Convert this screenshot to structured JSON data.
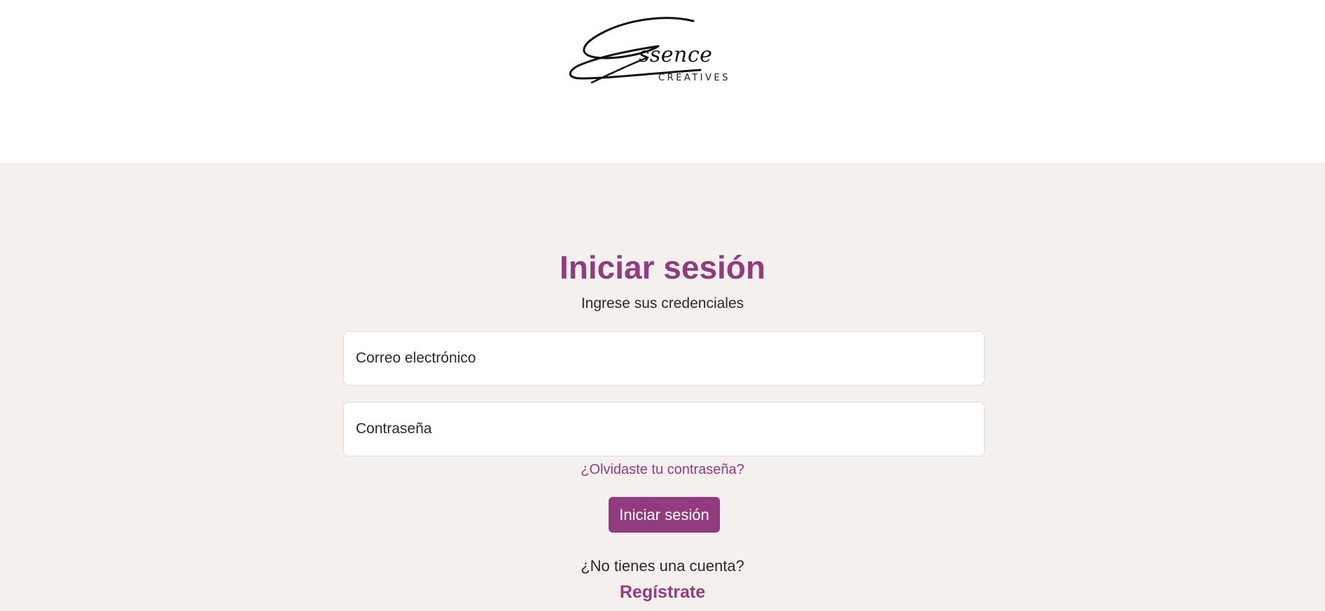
{
  "brand": {
    "logo_script": "Essence",
    "logo_subtext": "CREATIVES"
  },
  "login": {
    "title": "Iniciar sesión",
    "subtitle": "Ingrese sus credenciales",
    "email_placeholder": "Correo electrónico",
    "password_placeholder": "Contraseña",
    "forgot_link": "¿Olvidaste tu contraseña?",
    "submit_label": "Iniciar sesión",
    "no_account_text": "¿No tienes una cuenta?",
    "register_link": "Regístrate"
  },
  "colors": {
    "accent": "#923b7f",
    "page_background": "#f3f0ed",
    "header_background": "#ffffff",
    "text": "#2a2a2a"
  }
}
